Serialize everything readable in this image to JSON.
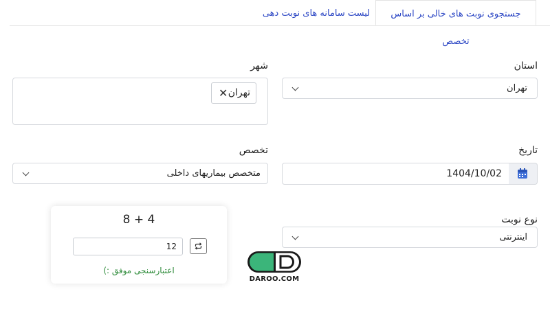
{
  "tabs": [
    {
      "label": "جستجوی نوبت های خالی بر اساس تخصص",
      "active": true
    },
    {
      "label": "لیست سامانه های نوبت دهی",
      "active": false
    }
  ],
  "form": {
    "province": {
      "label": "استان",
      "value": "تهران"
    },
    "city": {
      "label": "شهر",
      "chip": "تهران"
    },
    "date": {
      "label": "تاریخ",
      "value": "1404/10/02"
    },
    "specialty": {
      "label": "تخصص",
      "value": "متخصص بیماریهای داخلی"
    },
    "appointment_type": {
      "label": "نوع نوبت",
      "value": "اینترنتی"
    }
  },
  "captcha": {
    "question": "8 + 4",
    "answer": "12",
    "success": "اعتبارسنجی موفق :)"
  },
  "logo": {
    "text": "DAROO.COM"
  },
  "colors": {
    "link": "#2b46c4",
    "success": "#2e8b3a",
    "logo_green": "#3bb57a",
    "calendar_blue": "#3f6fd8"
  }
}
